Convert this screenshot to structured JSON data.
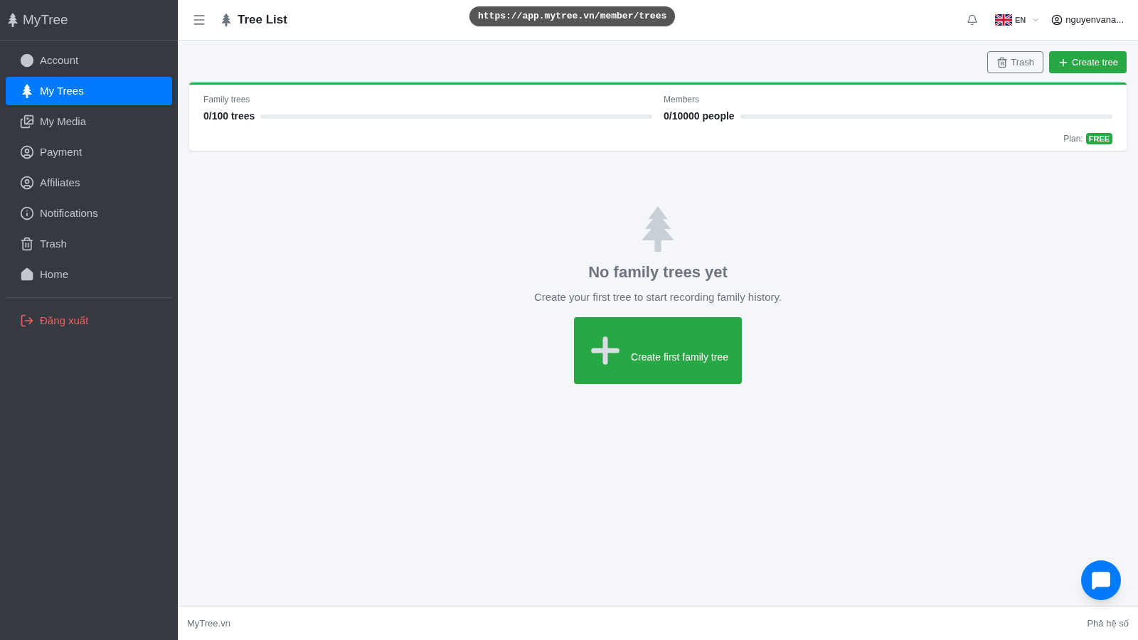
{
  "url_pill": "https://app.mytree.vn/member/trees",
  "sidebar": {
    "brand": "MyTree",
    "items": [
      {
        "label": "Account",
        "kind": "circle",
        "selected": false
      },
      {
        "label": "My Trees",
        "kind": "tree",
        "selected": true
      },
      {
        "label": "My Media",
        "kind": "images",
        "selected": false
      },
      {
        "label": "Payment",
        "kind": "user",
        "selected": false
      },
      {
        "label": "Affiliates",
        "kind": "user",
        "selected": false
      },
      {
        "label": "Notifications",
        "kind": "info",
        "selected": false
      },
      {
        "label": "Trash",
        "kind": "trash",
        "selected": false
      },
      {
        "label": "Home",
        "kind": "home",
        "selected": false
      }
    ],
    "logout": "Đăng xuất"
  },
  "header": {
    "title": "Tree List",
    "language": "EN",
    "user": "nguyenvana..."
  },
  "toolbar": {
    "trash": "Trash",
    "create": "Create tree"
  },
  "usage": {
    "meters": [
      {
        "label": "Family trees",
        "reading": "0/100 trees",
        "level": 0
      },
      {
        "label": "Members",
        "reading": "0/10000 people",
        "level": 0
      }
    ],
    "plan_label": "Plan:",
    "plan": "FREE"
  },
  "empty": {
    "title": "No family trees yet",
    "text": "Create your first tree to start recording family history.",
    "button": "Create first family tree"
  },
  "footer": {
    "left": "MyTree.vn",
    "right": "Phả hệ số"
  }
}
